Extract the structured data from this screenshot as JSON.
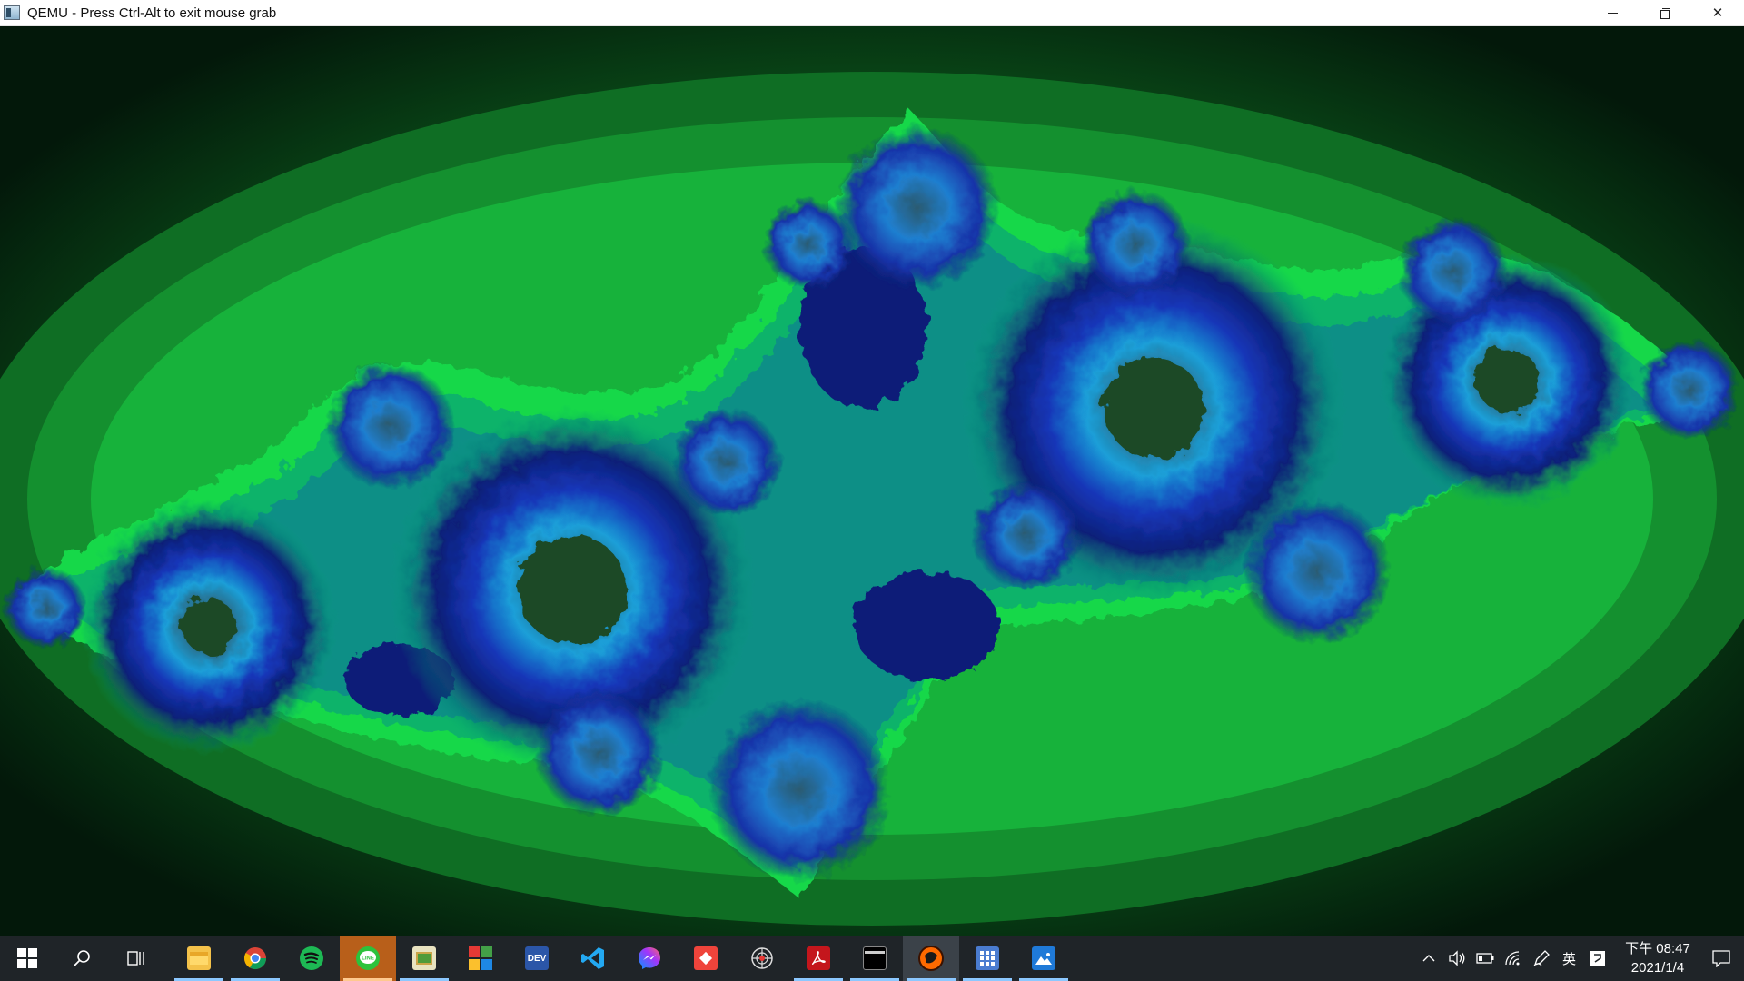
{
  "window": {
    "title": "QEMU - Press Ctrl-Alt to exit mouse grab",
    "minimize_label": "",
    "restore_label": "",
    "close_label": "✕"
  },
  "guest": {
    "description_colors": {
      "background": "#05200c",
      "outer_green": "#1aa83a",
      "bright_green": "#18d84a",
      "teal": "#10a870",
      "deep_blue": "#0b1f78",
      "cyan": "#19b6e0"
    }
  },
  "taskbar": {
    "apps": [
      {
        "name": "file-explorer-icon",
        "running": true
      },
      {
        "name": "chrome-icon",
        "running": true
      },
      {
        "name": "spotify-icon",
        "running": false
      },
      {
        "name": "line-icon",
        "running": true,
        "active": true
      },
      {
        "name": "image-editor-icon",
        "running": true
      },
      {
        "name": "colorful-grid-icon",
        "running": false
      },
      {
        "name": "devcpp-icon",
        "running": false,
        "label": "DEV"
      },
      {
        "name": "vscode-icon",
        "running": false
      },
      {
        "name": "messenger-icon",
        "running": false
      },
      {
        "name": "anydesk-icon",
        "running": false
      },
      {
        "name": "spider-icon",
        "running": false
      },
      {
        "name": "acrobat-icon",
        "running": true
      },
      {
        "name": "terminal-icon",
        "running": true
      },
      {
        "name": "qemu-icon",
        "running": true,
        "focused": true
      },
      {
        "name": "calculator-icon",
        "running": true
      },
      {
        "name": "photos-icon",
        "running": true
      }
    ],
    "tray": {
      "ime_label": "英",
      "time": "下午 08:47",
      "date": "2021/1/4"
    }
  }
}
